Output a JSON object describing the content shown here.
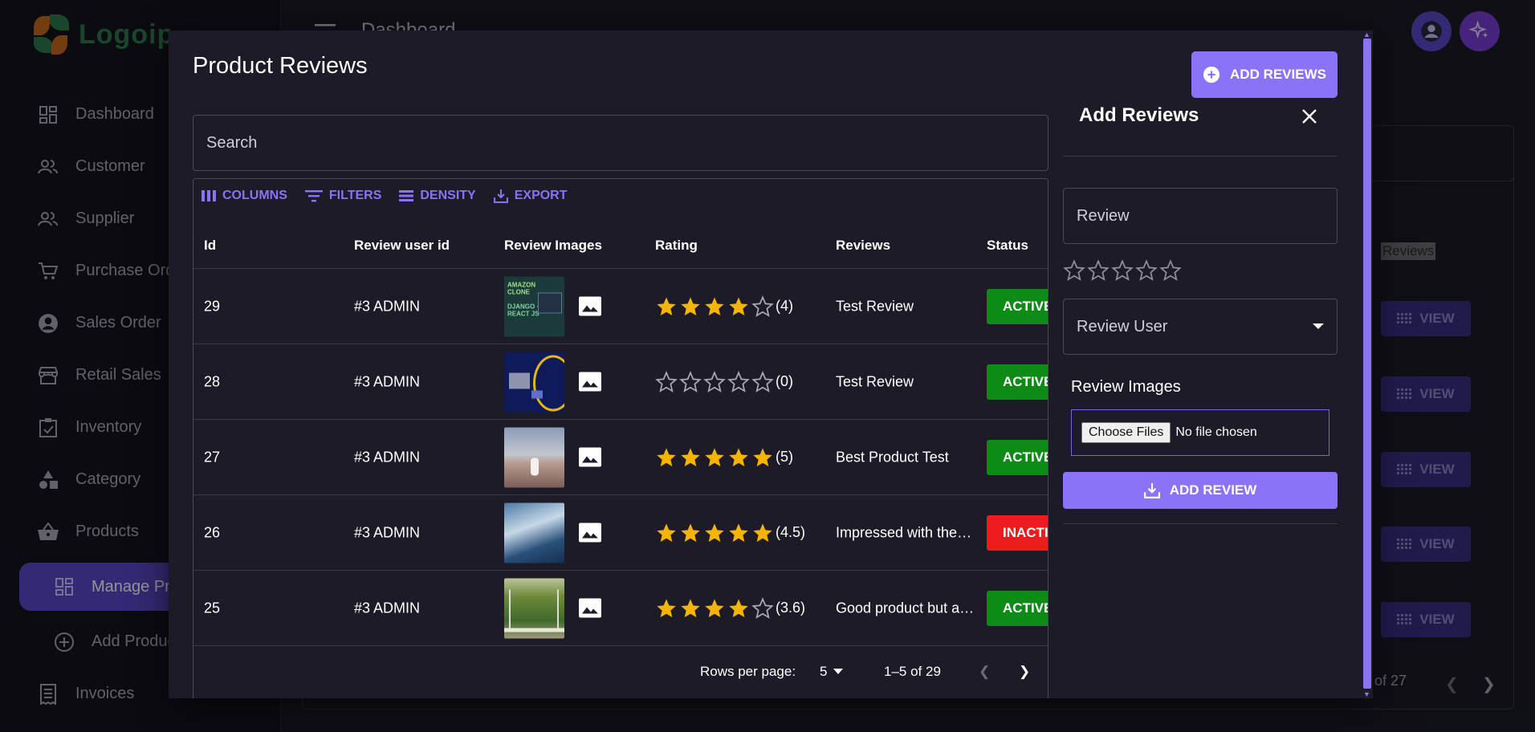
{
  "app": {
    "logo_text": "Logoip",
    "page_title": "Dashboard"
  },
  "sidebar": {
    "items": [
      {
        "label": "Dashboard",
        "icon": "dashboard-icon"
      },
      {
        "label": "Customer",
        "icon": "people-icon"
      },
      {
        "label": "Supplier",
        "icon": "people-icon"
      },
      {
        "label": "Purchase Order",
        "icon": "cart-icon"
      },
      {
        "label": "Sales Order",
        "icon": "account-circle-icon"
      },
      {
        "label": "Retail Sales",
        "icon": "store-icon"
      },
      {
        "label": "Inventory",
        "icon": "clipboard-check-icon"
      },
      {
        "label": "Category",
        "icon": "shapes-icon"
      },
      {
        "label": "Products",
        "icon": "basket-icon"
      },
      {
        "label": "Manage Products",
        "icon": "dashboard-icon"
      },
      {
        "label": "Add Product",
        "icon": "add-circle-icon"
      },
      {
        "label": "Invoices",
        "icon": "receipt-icon"
      }
    ]
  },
  "background": {
    "reviews_column": "Reviews",
    "view_label": "VIEW",
    "pager_text": "of 27"
  },
  "modal": {
    "title": "Product Reviews",
    "add_reviews_label": "ADD REVIEWS",
    "search_placeholder": "Search",
    "toolbar": {
      "columns": "COLUMNS",
      "filters": "FILTERS",
      "density": "DENSITY",
      "export": "EXPORT"
    },
    "columns": [
      "Id",
      "Review user id",
      "Review Images",
      "Rating",
      "Reviews",
      "Status"
    ],
    "rows": [
      {
        "id": "29",
        "user": "#3 ADMIN",
        "rating": 4,
        "rating_text": "(4)",
        "review": "Test Review",
        "status": "ACTIVE"
      },
      {
        "id": "28",
        "user": "#3 ADMIN",
        "rating": 0,
        "rating_text": "(0)",
        "review": "Test Review",
        "status": "ACTIVE"
      },
      {
        "id": "27",
        "user": "#3 ADMIN",
        "rating": 5,
        "rating_text": "(5)",
        "review": "Best Product Test",
        "status": "ACTIVE"
      },
      {
        "id": "26",
        "user": "#3 ADMIN",
        "rating": 5,
        "rating_text": "(4.5)",
        "review": "Impressed with the…",
        "status": "INACTIVE"
      },
      {
        "id": "25",
        "user": "#3 ADMIN",
        "rating": 4,
        "rating_text": "(3.6)",
        "review": "Good product but a…",
        "status": "ACTIVE"
      }
    ],
    "thumbnail_text": {
      "t1_line1": "AMAZON",
      "t1_line2": "CLONE",
      "t1_line3": "DJANGO +",
      "t1_line4": "REACT JS"
    },
    "pagination": {
      "rows_label": "Rows per page:",
      "rows_value": "5",
      "range": "1–5 of 29"
    }
  },
  "form": {
    "title": "Add Reviews",
    "review_placeholder": "Review",
    "user_placeholder": "Review User",
    "images_label": "Review Images",
    "file_button": "Choose Files",
    "file_status": "No file chosen",
    "submit_label": "ADD REVIEW"
  },
  "colors": {
    "accent": "#8b72f7",
    "active": "#0e8a17",
    "inactive": "#ec1c1c",
    "star": "#f4b400"
  }
}
